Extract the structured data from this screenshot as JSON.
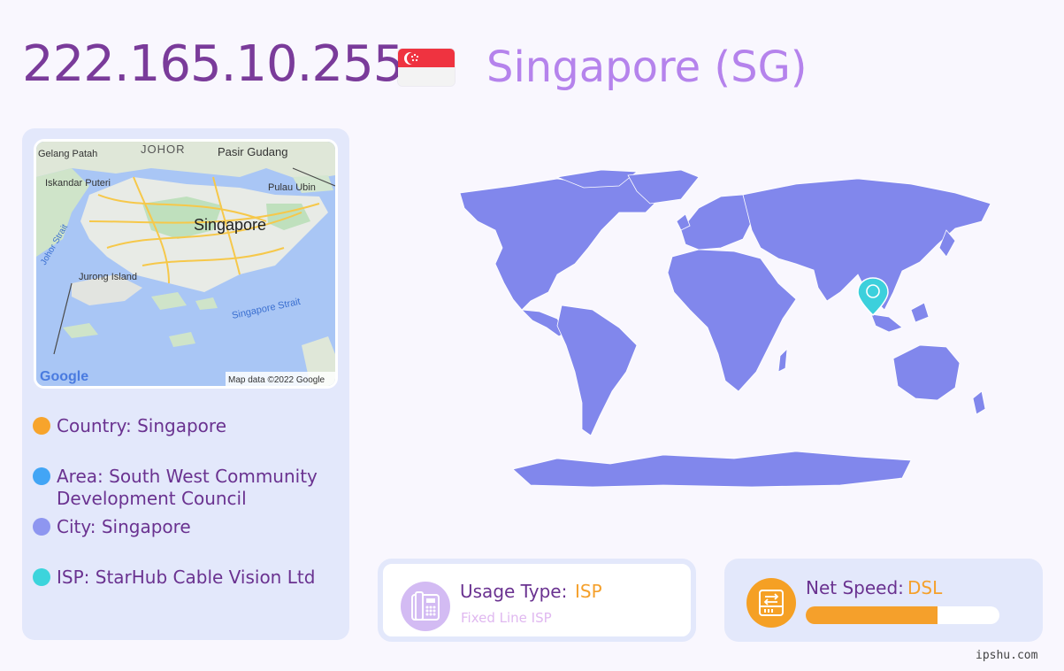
{
  "header": {
    "ip": "222.165.10.255",
    "country_title": "Singapore (SG)",
    "flag": "singapore-flag"
  },
  "map": {
    "labels": {
      "gelang_patah": "Gelang Patah",
      "johor": "JOHOR",
      "pasir_gudang": "Pasir Gudang",
      "iskandar_puteri": "Iskandar Puteri",
      "pulau_ubin": "Pulau Ubin",
      "singapore": "Singapore",
      "johor_strait": "Johor Strait",
      "jurong_island": "Jurong Island",
      "singapore_strait": "Singapore Strait",
      "google": "Google",
      "attribution": "Map data ©2022 Google"
    }
  },
  "info": {
    "country": "Country: Singapore",
    "area": "Area: South West Community Development Council",
    "city": "City: Singapore",
    "isp": "ISP: StarHub Cable Vision Ltd"
  },
  "colors": {
    "country_dot": "#f7a42c",
    "area_dot": "#42a5f5",
    "city_dot": "#8e96f0",
    "isp_dot": "#3cd4dc",
    "world_land": "#8187ec",
    "pin": "#3cd0dc"
  },
  "usage": {
    "label": "Usage Type:",
    "value": "ISP",
    "sub": "Fixed Line ISP",
    "icon": "phone-icon"
  },
  "speed": {
    "label": "Net Speed:",
    "value": "DSL",
    "icon": "hard-drive-icon",
    "level": 0.68
  },
  "footer": {
    "watermark": "ipshu.com"
  }
}
